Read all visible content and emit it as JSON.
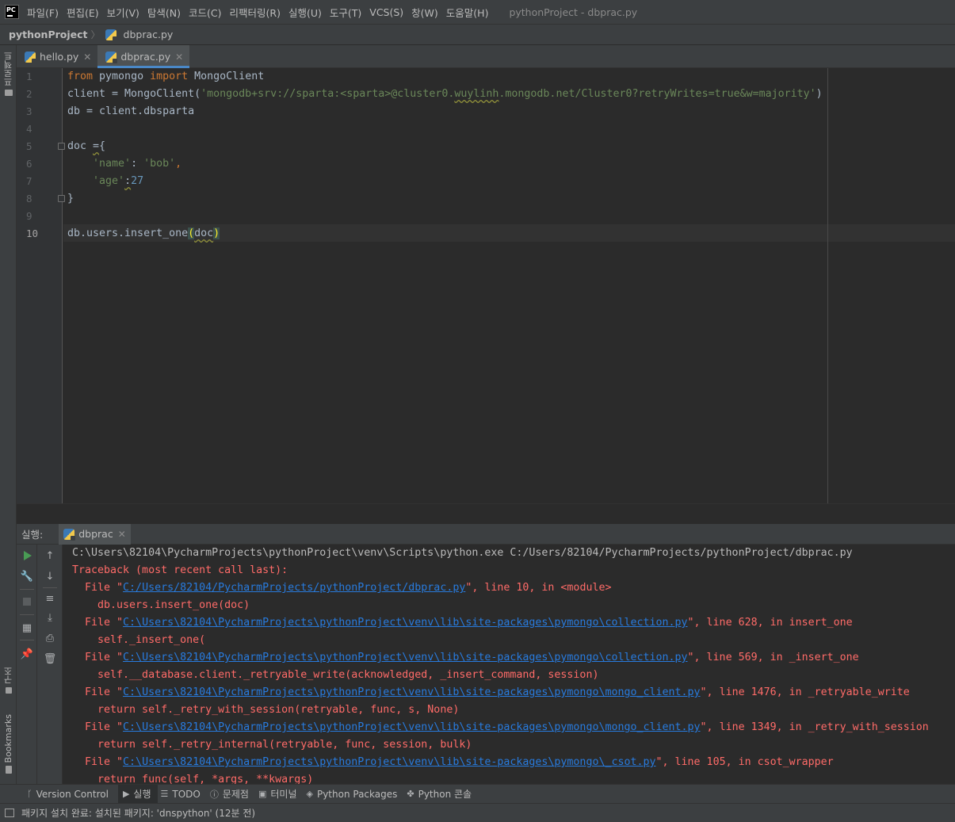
{
  "menubar": {
    "logo": "PC",
    "items": [
      "파일(F)",
      "편집(E)",
      "보기(V)",
      "탐색(N)",
      "코드(C)",
      "리팩터링(R)",
      "실행(U)",
      "도구(T)",
      "VCS(S)",
      "창(W)",
      "도움말(H)"
    ],
    "window_title": "pythonProject - dbprac.py"
  },
  "breadcrumb": {
    "project": "pythonProject",
    "file": "dbprac.py"
  },
  "left_strip": {
    "project_label": "프로젝트",
    "structure_label": "구조",
    "bookmarks_label": "Bookmarks"
  },
  "editor_tabs": [
    {
      "label": "hello.py",
      "active": false
    },
    {
      "label": "dbprac.py",
      "active": true
    }
  ],
  "editor": {
    "line_numbers": [
      "1",
      "2",
      "3",
      "4",
      "5",
      "6",
      "7",
      "8",
      "9",
      "10"
    ],
    "current_line": "10",
    "code": {
      "l1_from": "from",
      "l1_mod": " pymongo ",
      "l1_import": "import",
      "l1_name": " MongoClient",
      "l2_pre": "client = MongoClient(",
      "l2_str_a": "'mongodb+srv://sparta:<sparta>@cluster0.",
      "l2_str_b": "wuylinh",
      "l2_str_c": ".mongodb.net/Cluster0?retryWrites=true&w=majority'",
      "l2_post": ")",
      "l3": "db = client.dbsparta",
      "l5_a": "doc ",
      "l5_b": "=",
      "l5_c": "{",
      "l6_indent": "    ",
      "l6_key": "'name'",
      "l6_colon": ": ",
      "l6_val": "'bob'",
      "l6_comma": ",",
      "l7_indent": "    ",
      "l7_key": "'age'",
      "l7_colon": ":",
      "l7_val": "27",
      "l8": "}",
      "l10_pre": "db.users.insert_one",
      "l10_open": "(",
      "l10_arg": "doc",
      "l10_close": ")"
    }
  },
  "run_panel": {
    "label": "실행:",
    "tab": "dbprac",
    "console": {
      "cmd": "C:\\Users\\82104\\PycharmProjects\\pythonProject\\venv\\Scripts\\python.exe C:/Users/82104/PycharmProjects/pythonProject/dbprac.py",
      "traceback": "Traceback (most recent call last):",
      "frames": [
        {
          "pre": "  File \"",
          "path": "C:/Users/82104/PycharmProjects/pythonProject/dbprac.py",
          "post": "\", line 10, in <module>",
          "code": "    db.users.insert_one(doc)"
        },
        {
          "pre": "  File \"",
          "path": "C:\\Users\\82104\\PycharmProjects\\pythonProject\\venv\\lib\\site-packages\\pymongo\\collection.py",
          "post": "\", line 628, in insert_one",
          "code": "    self._insert_one("
        },
        {
          "pre": "  File \"",
          "path": "C:\\Users\\82104\\PycharmProjects\\pythonProject\\venv\\lib\\site-packages\\pymongo\\collection.py",
          "post": "\", line 569, in _insert_one",
          "code": "    self.__database.client._retryable_write(acknowledged, _insert_command, session)"
        },
        {
          "pre": "  File \"",
          "path": "C:\\Users\\82104\\PycharmProjects\\pythonProject\\venv\\lib\\site-packages\\pymongo\\mongo_client.py",
          "post": "\", line 1476, in _retryable_write",
          "code": "    return self._retry_with_session(retryable, func, s, None)"
        },
        {
          "pre": "  File \"",
          "path": "C:\\Users\\82104\\PycharmProjects\\pythonProject\\venv\\lib\\site-packages\\pymongo\\mongo_client.py",
          "post": "\", line 1349, in _retry_with_session",
          "code": "    return self._retry_internal(retryable, func, session, bulk)"
        },
        {
          "pre": "  File \"",
          "path": "C:\\Users\\82104\\PycharmProjects\\pythonProject\\venv\\lib\\site-packages\\pymongo\\_csot.py",
          "post": "\", line 105, in csot_wrapper",
          "code": "    return func(self, *args, **kwargs)"
        }
      ]
    }
  },
  "bottom_tabs": [
    {
      "label": "Version Control",
      "icon": "branch-icon",
      "active": false
    },
    {
      "label": "실행",
      "icon": "run-icon",
      "active": true
    },
    {
      "label": "TODO",
      "icon": "list-icon",
      "active": false
    },
    {
      "label": "문제점",
      "icon": "problems-icon",
      "active": false
    },
    {
      "label": "터미널",
      "icon": "terminal-icon",
      "active": false
    },
    {
      "label": "Python Packages",
      "icon": "packages-icon",
      "active": false
    },
    {
      "label": "Python 콘솔",
      "icon": "python-console-icon",
      "active": false
    }
  ],
  "status_bar": {
    "message": "패키지 설치 완료: 설치된 패키지: 'dnspython' (12분 전)"
  },
  "colors": {
    "keyword": "#cc7832",
    "string": "#6a8759",
    "number": "#6897bb",
    "error": "#ff6b68",
    "link": "#287bde",
    "run_green": "#499c54"
  }
}
